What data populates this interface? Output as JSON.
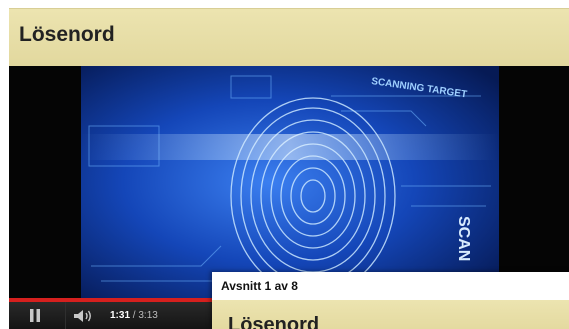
{
  "header": {
    "title": "Lösenord"
  },
  "player": {
    "current_time": "1:31",
    "separator": " / ",
    "duration": "3:13",
    "progress_fraction": 0.47,
    "accent_color": "#d6201e",
    "pause_icon": "pause-icon",
    "volume_icon": "volume-icon"
  },
  "video_overlay": {
    "scanning_text": "SCANNING TARGET",
    "scan_text": "SCAN"
  },
  "chapters": {
    "label": "Avsnitt 1 av 8",
    "current_title": "Lösenord"
  }
}
